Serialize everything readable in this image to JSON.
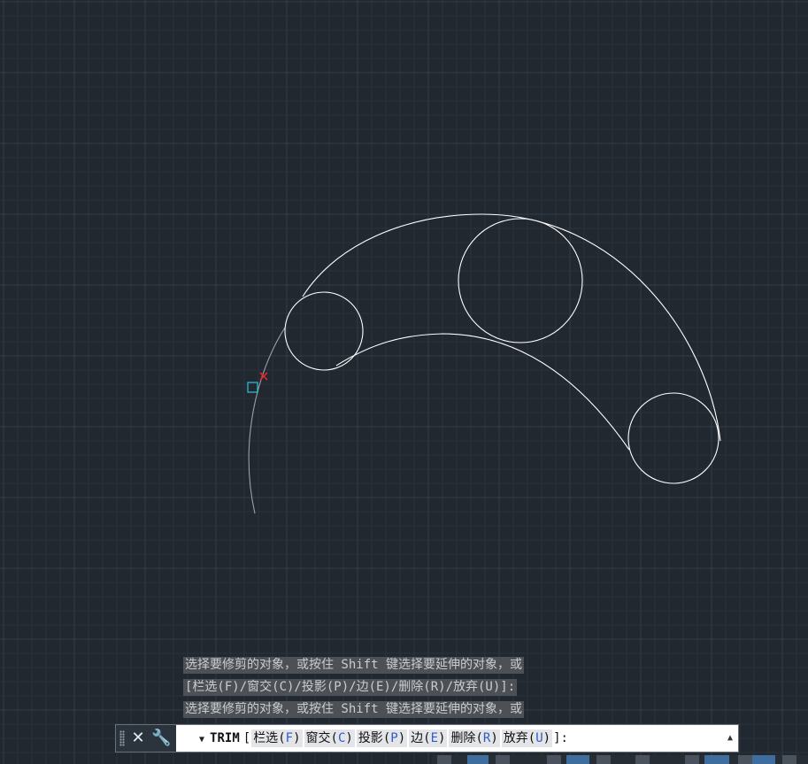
{
  "command_history": [
    "选择要修剪的对象，或按住 Shift 键选择要延伸的对象，或",
    "[栏选(F)/窗交(C)/投影(P)/边(E)/删除(R)/放弃(U)]:",
    "选择要修剪的对象，或按住 Shift 键选择要延伸的对象，或"
  ],
  "command_line": {
    "command": "TRIM",
    "open_bracket": "[",
    "options": [
      {
        "label": "栏选",
        "key": "F"
      },
      {
        "label": "窗交",
        "key": "C"
      },
      {
        "label": "投影",
        "key": "P"
      },
      {
        "label": "边",
        "key": "E"
      },
      {
        "label": "删除",
        "key": "R"
      },
      {
        "label": "放弃",
        "key": "U"
      }
    ],
    "close": "]:"
  },
  "colors": {
    "background": "#212830",
    "grid_minor": "#2a323b",
    "grid_major": "#343d47",
    "geometry": "#ffffff",
    "cursor_box": "#29c6dc",
    "cursor_x": "#e0262a"
  },
  "icons": {
    "close": "close-icon",
    "customize": "wrench-icon",
    "history": "chevron-down-icon",
    "scroll": "triangle-up-icon"
  }
}
